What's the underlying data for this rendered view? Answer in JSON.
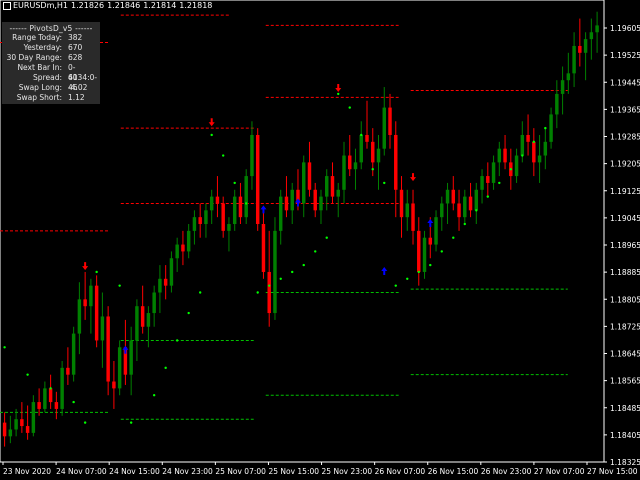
{
  "header": {
    "symbol": "EURUSDm,H1",
    "open": "1.21826",
    "high": "1.21846",
    "low": "1.21814",
    "close": "1.21818"
  },
  "info_panel": {
    "title": "------ PivotsD_v5 ------",
    "rows": [
      {
        "label": "Range Today:",
        "value": "382"
      },
      {
        "label": "Yesterday:",
        "value": "670"
      },
      {
        "label": "30 Day Range:",
        "value": "628"
      },
      {
        "label": "Next Bar In:",
        "value": "0-4134:0-46"
      },
      {
        "label": "Spread:",
        "value": "60"
      },
      {
        "label": "Swap Long:",
        "value": "-4.02"
      },
      {
        "label": "Swap Short:",
        "value": "1.12"
      }
    ]
  },
  "colors": {
    "background": "#000000",
    "bull_candle": "#008000",
    "bear_candle": "#ff0000",
    "resistance_line": "#ff0000",
    "support_line": "#00c000",
    "trail_dots": "#00ff00",
    "arrow_up": "#0000ff",
    "arrow_down": "#ff0000",
    "axis": "#ffffff"
  },
  "price_axis": [
    "1.19605",
    "1.19525",
    "1.19445",
    "1.19365",
    "1.19285",
    "1.19205",
    "1.19125",
    "1.19045",
    "1.18965",
    "1.18885",
    "1.18805",
    "1.18725",
    "1.18645",
    "1.18565",
    "1.18485",
    "1.18405",
    "1.18325"
  ],
  "time_axis": [
    "23 Nov 2020",
    "24 Nov 07:00",
    "24 Nov 15:00",
    "24 Nov 23:00",
    "25 Nov 07:00",
    "25 Nov 15:00",
    "25 Nov 23:00",
    "26 Nov 07:00",
    "26 Nov 15:00",
    "26 Nov 23:00",
    "27 Nov 07:00",
    "27 Nov 15:00"
  ],
  "chart_data": {
    "type": "candlestick",
    "symbol": "EURUSDm",
    "timeframe": "H1",
    "y_range": [
      1.18325,
      1.19645
    ],
    "candles": [
      [
        1.1844,
        1.1847,
        1.1837,
        1.184
      ],
      [
        1.184,
        1.1846,
        1.1838,
        1.1842
      ],
      [
        1.1842,
        1.1848,
        1.184,
        1.1845
      ],
      [
        1.1845,
        1.185,
        1.1841,
        1.1843
      ],
      [
        1.1843,
        1.1849,
        1.1839,
        1.1841
      ],
      [
        1.1841,
        1.1852,
        1.184,
        1.185
      ],
      [
        1.185,
        1.1854,
        1.1846,
        1.1848
      ],
      [
        1.1848,
        1.1856,
        1.1847,
        1.1854
      ],
      [
        1.1854,
        1.1858,
        1.1848,
        1.185
      ],
      [
        1.185,
        1.1853,
        1.1845,
        1.1848
      ],
      [
        1.1848,
        1.1862,
        1.1846,
        1.186
      ],
      [
        1.186,
        1.1866,
        1.1855,
        1.1858
      ],
      [
        1.1858,
        1.1872,
        1.1856,
        1.187
      ],
      [
        1.187,
        1.1885,
        1.1864,
        1.188
      ],
      [
        1.188,
        1.1888,
        1.1874,
        1.1878
      ],
      [
        1.1878,
        1.1886,
        1.187,
        1.1884
      ],
      [
        1.1884,
        1.1887,
        1.1866,
        1.1868
      ],
      [
        1.1868,
        1.1882,
        1.186,
        1.1875
      ],
      [
        1.1875,
        1.1878,
        1.1852,
        1.1856
      ],
      [
        1.1856,
        1.1862,
        1.1848,
        1.1854
      ],
      [
        1.1854,
        1.1868,
        1.1852,
        1.1866
      ],
      [
        1.1866,
        1.1874,
        1.1855,
        1.1858
      ],
      [
        1.1858,
        1.1872,
        1.1852,
        1.1868
      ],
      [
        1.1868,
        1.188,
        1.1862,
        1.1878
      ],
      [
        1.1878,
        1.1884,
        1.187,
        1.1872
      ],
      [
        1.1872,
        1.1878,
        1.1866,
        1.1876
      ],
      [
        1.1876,
        1.1884,
        1.1872,
        1.1882
      ],
      [
        1.1882,
        1.189,
        1.1876,
        1.1886
      ],
      [
        1.1886,
        1.189,
        1.188,
        1.1884
      ],
      [
        1.1884,
        1.1894,
        1.1882,
        1.1892
      ],
      [
        1.1892,
        1.1898,
        1.1888,
        1.1896
      ],
      [
        1.1896,
        1.19,
        1.189,
        1.1894
      ],
      [
        1.1894,
        1.1902,
        1.1892,
        1.19
      ],
      [
        1.19,
        1.1906,
        1.1896,
        1.1904
      ],
      [
        1.1904,
        1.1908,
        1.1898,
        1.1902
      ],
      [
        1.1902,
        1.1908,
        1.1898,
        1.1906
      ],
      [
        1.1906,
        1.1912,
        1.1902,
        1.191
      ],
      [
        1.191,
        1.1916,
        1.1904,
        1.1908
      ],
      [
        1.1908,
        1.191,
        1.1898,
        1.19
      ],
      [
        1.19,
        1.1904,
        1.1894,
        1.1902
      ],
      [
        1.1902,
        1.1912,
        1.19,
        1.191
      ],
      [
        1.191,
        1.1914,
        1.1902,
        1.1904
      ],
      [
        1.1904,
        1.1918,
        1.1902,
        1.1916
      ],
      [
        1.1916,
        1.1932,
        1.1912,
        1.1928
      ],
      [
        1.1928,
        1.193,
        1.19,
        1.1902
      ],
      [
        1.1902,
        1.1906,
        1.1886,
        1.1888
      ],
      [
        1.1888,
        1.19,
        1.1872,
        1.1876
      ],
      [
        1.1876,
        1.1904,
        1.1874,
        1.19
      ],
      [
        1.19,
        1.1912,
        1.1896,
        1.191
      ],
      [
        1.191,
        1.1916,
        1.1904,
        1.1906
      ],
      [
        1.1906,
        1.1914,
        1.1902,
        1.1912
      ],
      [
        1.1912,
        1.1918,
        1.1906,
        1.1908
      ],
      [
        1.1908,
        1.1922,
        1.1904,
        1.192
      ],
      [
        1.192,
        1.1926,
        1.191,
        1.1912
      ],
      [
        1.1912,
        1.1914,
        1.1904,
        1.1906
      ],
      [
        1.1906,
        1.1912,
        1.1902,
        1.191
      ],
      [
        1.191,
        1.1918,
        1.1906,
        1.1916
      ],
      [
        1.1916,
        1.192,
        1.1908,
        1.191
      ],
      [
        1.191,
        1.1914,
        1.1904,
        1.1912
      ],
      [
        1.1912,
        1.1926,
        1.1908,
        1.1922
      ],
      [
        1.1922,
        1.1928,
        1.1916,
        1.1918
      ],
      [
        1.1918,
        1.1924,
        1.1912,
        1.192
      ],
      [
        1.192,
        1.1932,
        1.1918,
        1.1928
      ],
      [
        1.1928,
        1.1938,
        1.1924,
        1.1926
      ],
      [
        1.1926,
        1.193,
        1.1916,
        1.192
      ],
      [
        1.192,
        1.1928,
        1.1912,
        1.1924
      ],
      [
        1.1924,
        1.1942,
        1.1922,
        1.1936
      ],
      [
        1.1936,
        1.194,
        1.1924,
        1.1928
      ],
      [
        1.1928,
        1.1932,
        1.1904,
        1.1912
      ],
      [
        1.1912,
        1.1916,
        1.1898,
        1.1904
      ],
      [
        1.1904,
        1.1912,
        1.19,
        1.1908
      ],
      [
        1.1908,
        1.1912,
        1.1896,
        1.19
      ],
      [
        1.19,
        1.1904,
        1.1884,
        1.1888
      ],
      [
        1.1888,
        1.19,
        1.1886,
        1.1898
      ],
      [
        1.1898,
        1.1904,
        1.1892,
        1.1896
      ],
      [
        1.1896,
        1.1906,
        1.1894,
        1.1904
      ],
      [
        1.1904,
        1.191,
        1.19,
        1.1908
      ],
      [
        1.1908,
        1.1914,
        1.1902,
        1.1912
      ],
      [
        1.1912,
        1.1916,
        1.1906,
        1.1908
      ],
      [
        1.1908,
        1.1912,
        1.19,
        1.1904
      ],
      [
        1.1904,
        1.1912,
        1.1902,
        1.191
      ],
      [
        1.191,
        1.1914,
        1.1904,
        1.1906
      ],
      [
        1.1906,
        1.1914,
        1.1902,
        1.1912
      ],
      [
        1.1912,
        1.1918,
        1.1908,
        1.1916
      ],
      [
        1.1916,
        1.192,
        1.191,
        1.1914
      ],
      [
        1.1914,
        1.1922,
        1.1912,
        1.192
      ],
      [
        1.192,
        1.1926,
        1.1916,
        1.1924
      ],
      [
        1.1924,
        1.1928,
        1.1918,
        1.192
      ],
      [
        1.192,
        1.1924,
        1.1912,
        1.1916
      ],
      [
        1.1916,
        1.1924,
        1.1914,
        1.1922
      ],
      [
        1.1922,
        1.1932,
        1.192,
        1.1928
      ],
      [
        1.1928,
        1.1934,
        1.1922,
        1.1926
      ],
      [
        1.1926,
        1.193,
        1.1916,
        1.192
      ],
      [
        1.192,
        1.1928,
        1.1914,
        1.1922
      ],
      [
        1.1922,
        1.193,
        1.1918,
        1.1926
      ],
      [
        1.1926,
        1.1936,
        1.1924,
        1.1934
      ],
      [
        1.1934,
        1.1944,
        1.193,
        1.194
      ],
      [
        1.194,
        1.1948,
        1.1934,
        1.1944
      ],
      [
        1.1944,
        1.1952,
        1.194,
        1.1946
      ],
      [
        1.1946,
        1.1958,
        1.1942,
        1.1954
      ],
      [
        1.1954,
        1.1962,
        1.1948,
        1.1952
      ],
      [
        1.1952,
        1.1958,
        1.1944,
        1.1956
      ],
      [
        1.1956,
        1.1962,
        1.195,
        1.1958
      ],
      [
        1.1958,
        1.1964,
        1.1952,
        1.196
      ]
    ],
    "resistance_levels": [
      {
        "price": 1.1963,
        "from": 0.2,
        "to": 0.38
      },
      {
        "price": 1.1955,
        "from": 0.0,
        "to": 0.18
      },
      {
        "price": 1.196,
        "from": 0.44,
        "to": 0.66
      },
      {
        "price": 1.1941,
        "from": 0.68,
        "to": 0.94
      },
      {
        "price": 1.1939,
        "from": 0.44,
        "to": 0.66
      },
      {
        "price": 1.193,
        "from": 0.2,
        "to": 0.42
      },
      {
        "price": 1.1908,
        "from": 0.2,
        "to": 0.66
      },
      {
        "price": 1.19,
        "from": 0.0,
        "to": 0.18
      }
    ],
    "support_levels": [
      {
        "price": 1.1882,
        "from": 0.44,
        "to": 0.66
      },
      {
        "price": 1.1883,
        "from": 0.68,
        "to": 0.94
      },
      {
        "price": 1.1868,
        "from": 0.2,
        "to": 0.42
      },
      {
        "price": 1.1858,
        "from": 0.68,
        "to": 0.94
      },
      {
        "price": 1.1852,
        "from": 0.44,
        "to": 0.66
      },
      {
        "price": 1.1847,
        "from": 0.0,
        "to": 0.18
      },
      {
        "price": 1.1845,
        "from": 0.2,
        "to": 0.42
      }
    ],
    "arrows": [
      {
        "dir": "down",
        "index": 14,
        "price": 1.189
      },
      {
        "dir": "up",
        "index": 21,
        "price": 1.1865
      },
      {
        "dir": "down",
        "index": 36,
        "price": 1.1932
      },
      {
        "dir": "up",
        "index": 45,
        "price": 1.1906
      },
      {
        "dir": "up",
        "index": 51,
        "price": 1.1908
      },
      {
        "dir": "down",
        "index": 58,
        "price": 1.1942
      },
      {
        "dir": "up",
        "index": 66,
        "price": 1.1888
      },
      {
        "dir": "down",
        "index": 71,
        "price": 1.1916
      },
      {
        "dir": "up",
        "index": 74,
        "price": 1.1902
      }
    ],
    "trail_points": [
      [
        0,
        1.1866
      ],
      [
        4,
        1.1858
      ],
      [
        8,
        1.1854
      ],
      [
        12,
        1.185
      ],
      [
        14,
        1.1844
      ],
      [
        16,
        1.1888
      ],
      [
        20,
        1.1884
      ],
      [
        22,
        1.1844
      ],
      [
        26,
        1.1852
      ],
      [
        28,
        1.186
      ],
      [
        30,
        1.1868
      ],
      [
        32,
        1.1876
      ],
      [
        34,
        1.1882
      ],
      [
        36,
        1.1928
      ],
      [
        38,
        1.1922
      ],
      [
        40,
        1.1914
      ],
      [
        42,
        1.1908
      ],
      [
        44,
        1.1882
      ],
      [
        46,
        1.1884
      ],
      [
        48,
        1.1886
      ],
      [
        50,
        1.1888
      ],
      [
        52,
        1.189
      ],
      [
        54,
        1.1894
      ],
      [
        56,
        1.1898
      ],
      [
        58,
        1.194
      ],
      [
        60,
        1.1936
      ],
      [
        62,
        1.1928
      ],
      [
        64,
        1.1918
      ],
      [
        66,
        1.1914
      ],
      [
        68,
        1.1884
      ],
      [
        70,
        1.1886
      ],
      [
        72,
        1.1888
      ],
      [
        74,
        1.189
      ],
      [
        76,
        1.1894
      ],
      [
        78,
        1.1898
      ],
      [
        80,
        1.1902
      ],
      [
        82,
        1.1906
      ],
      [
        84,
        1.191
      ],
      [
        86,
        1.1914
      ],
      [
        88,
        1.1918
      ],
      [
        90,
        1.1922
      ],
      [
        92,
        1.1926
      ],
      [
        94,
        1.193
      ]
    ]
  }
}
